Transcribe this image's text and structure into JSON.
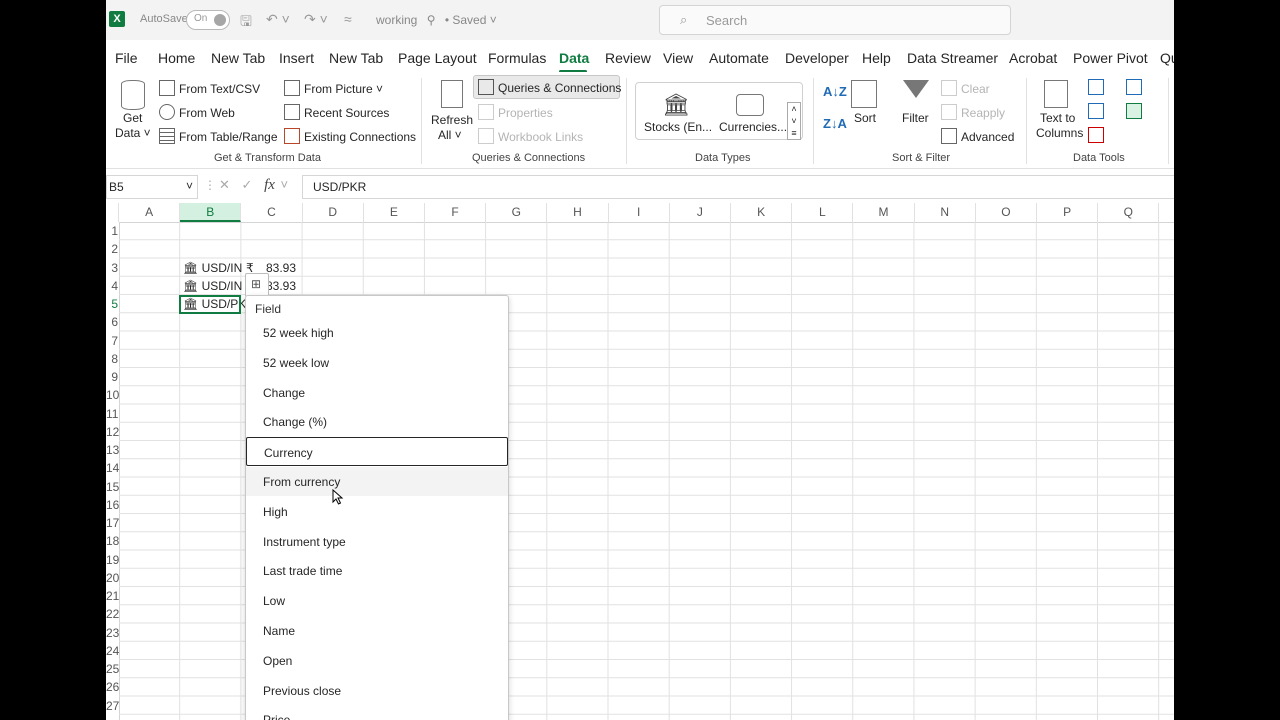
{
  "titlebar": {
    "autosave_label": "AutoSave",
    "autosave_state": "On",
    "doc_title": "working",
    "save_status": "• Saved",
    "search_placeholder": "Search",
    "logo_letter": "X"
  },
  "tabs": [
    "File",
    "Home",
    "New Tab",
    "Insert",
    "New Tab",
    "Page Layout",
    "Formulas",
    "Data",
    "Review",
    "View",
    "Automate",
    "Developer",
    "Help",
    "Data Streamer",
    "Acrobat",
    "Power Pivot",
    "Qu"
  ],
  "active_tab": "Data",
  "ribbon": {
    "get_transform": {
      "get_data_line1": "Get",
      "get_data_line2": "Data ˅",
      "from_text_csv": "From Text/CSV",
      "from_web": "From Web",
      "from_table_range": "From Table/Range",
      "from_picture": "From Picture ˅",
      "recent_sources": "Recent Sources",
      "existing_connections": "Existing Connections",
      "label": "Get & Transform Data"
    },
    "queries": {
      "refresh_line1": "Refresh",
      "refresh_line2": "All ˅",
      "queries_connections": "Queries & Connections",
      "properties": "Properties",
      "workbook_links": "Workbook Links",
      "label": "Queries & Connections"
    },
    "data_types": {
      "stocks": "Stocks (En...",
      "currencies": "Currencies...",
      "label": "Data Types"
    },
    "sort_filter": {
      "sort": "Sort",
      "filter": "Filter",
      "clear": "Clear",
      "reapply": "Reapply",
      "advanced": "Advanced",
      "label": "Sort & Filter"
    },
    "data_tools": {
      "text_to_columns_line1": "Text to",
      "text_to_columns_line2": "Columns",
      "label": "Data Tools"
    }
  },
  "formula_bar": {
    "name_box": "B5",
    "fx": "fx",
    "formula": "USD/PKR"
  },
  "columns": [
    "A",
    "B",
    "C",
    "D",
    "E",
    "F",
    "G",
    "H",
    "I",
    "J",
    "K",
    "L",
    "M",
    "N",
    "O",
    "P",
    "Q"
  ],
  "selected_column": "B",
  "rows": [
    "1",
    "2",
    "3",
    "4",
    "5",
    "6",
    "7",
    "8",
    "9",
    "10",
    "11",
    "12",
    "13",
    "14",
    "15",
    "16",
    "17",
    "18",
    "19",
    "20",
    "21",
    "22",
    "23",
    "24",
    "25",
    "26",
    "27"
  ],
  "cells": {
    "b3": "🏛 USD/IN",
    "c3_symbol": "₹",
    "c3": "83.93",
    "b4": "🏛 USD/IN",
    "c4": "83.93",
    "b5": "🏛 USD/PK"
  },
  "field_dropdown": {
    "title": "Field",
    "items": [
      "52 week high",
      "52 week low",
      "Change",
      "Change (%)",
      "Currency",
      "From currency",
      "High",
      "Instrument type",
      "Last trade time",
      "Low",
      "Name",
      "Open",
      "Previous close",
      "Price"
    ],
    "focused_index": 4,
    "hover_index": 5
  }
}
